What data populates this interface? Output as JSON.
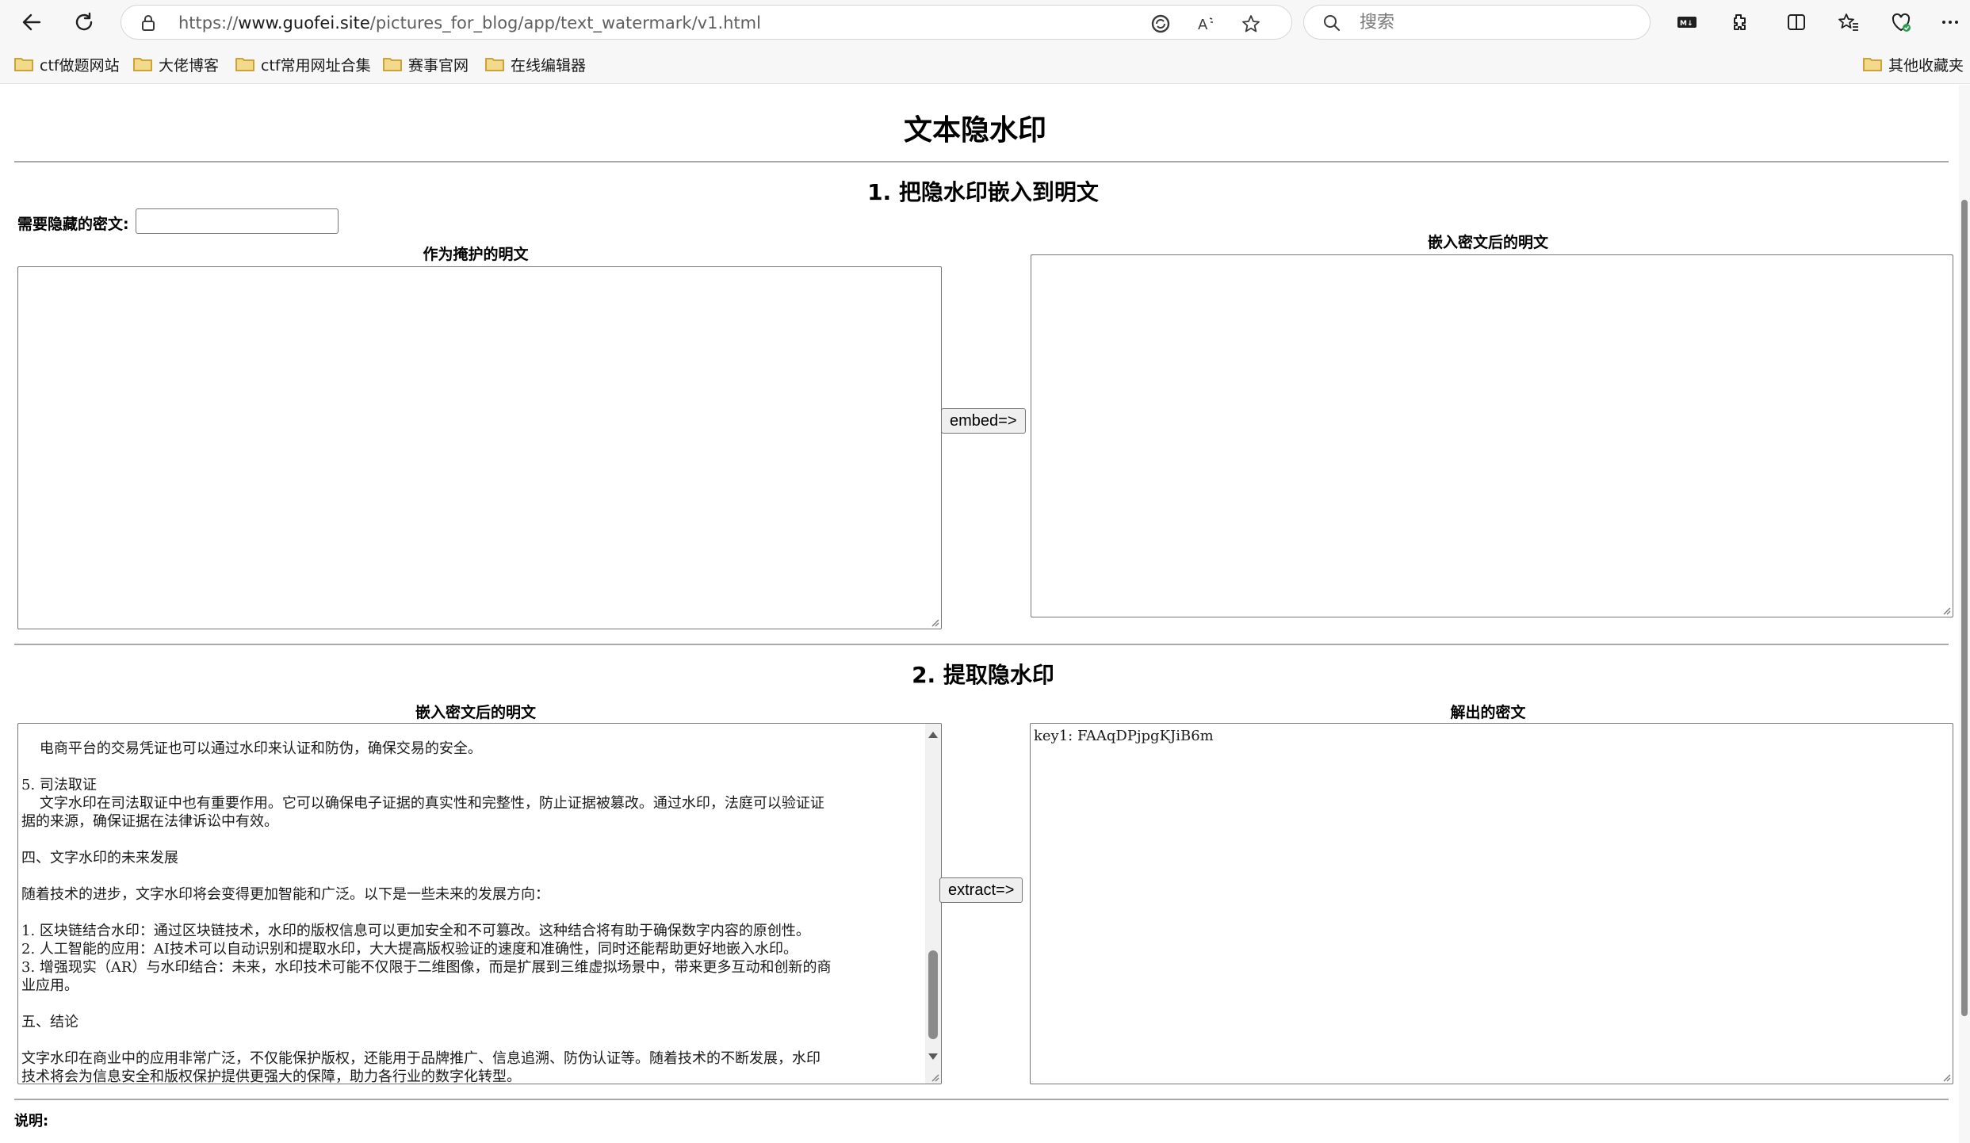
{
  "browser": {
    "url_prefix": "https://",
    "url_host": "www.guofei.site",
    "url_path": "/pictures_for_blog/app/text_watermark/v1.html",
    "search_placeholder": "搜索",
    "icons": [
      "back-icon",
      "refresh-icon",
      "lock-icon",
      "translate-icon",
      "read-aloud-icon",
      "favorite-star-icon",
      "search-icon",
      "markdown-icon",
      "extensions-icon",
      "split-screen-icon",
      "favorites-icon",
      "browser-essentials-icon",
      "more-icon"
    ]
  },
  "bookmarks": {
    "items": [
      "ctf做题网站",
      "大佬博客",
      "ctf常用网址合集",
      "赛事官网",
      "在线编辑器"
    ],
    "other": "其他收藏夹"
  },
  "page": {
    "title": "文本隐水印",
    "section1": {
      "heading": "1. 把隐水印嵌入到明文",
      "secret_label": "需要隐藏的密文:",
      "secret_value": "",
      "cover_label": "作为掩护的明文",
      "output_label": "嵌入密文后的明文",
      "embed_button": "embed=>"
    },
    "section2": {
      "heading": "2. 提取隐水印",
      "input_label": "嵌入密文后的明文",
      "output_label": "解出的密文",
      "extract_button": "extract=>",
      "input_lines": [
        "    电商平台的交易凭证也可以通过水印来认证和防伪，确保交易的安全。",
        "",
        "5. 司法取证",
        "    文字水印在司法取证中也有重要作用。它可以确保电子证据的真实性和完整性，防止证据被篡改。通过水印，法庭可以验证证",
        "据的来源，确保证据在法律诉讼中有效。",
        "",
        "四、文字水印的未来发展",
        "",
        "随着技术的进步，文字水印将会变得更加智能和广泛。以下是一些未来的发展方向：",
        "",
        "1. 区块链结合水印：通过区块链技术，水印的版权信息可以更加安全和不可篡改。这种结合将有助于确保数字内容的原创性。",
        "2. 人工智能的应用：AI技术可以自动识别和提取水印，大大提高版权验证的速度和准确性，同时还能帮助更好地嵌入水印。",
        "3. 增强现实（AR）与水印结合：未来，水印技术可能不仅限于二维图像，而是扩展到三维虚拟场景中，带来更多互动和创新的商",
        "业应用。",
        "",
        "五、结论",
        "",
        "文字水印在商业中的应用非常广泛，不仅能保护版权，还能用于品牌推广、信息追溯、防伪认证等。随着技术的不断发展，水印",
        "技术将会为信息安全和版权保护提供更强大的保障，助力各行业的数字化转型。"
      ],
      "output_text": "key1: FAAqDPjpgKJiB6m"
    },
    "note_label": "说明:"
  }
}
